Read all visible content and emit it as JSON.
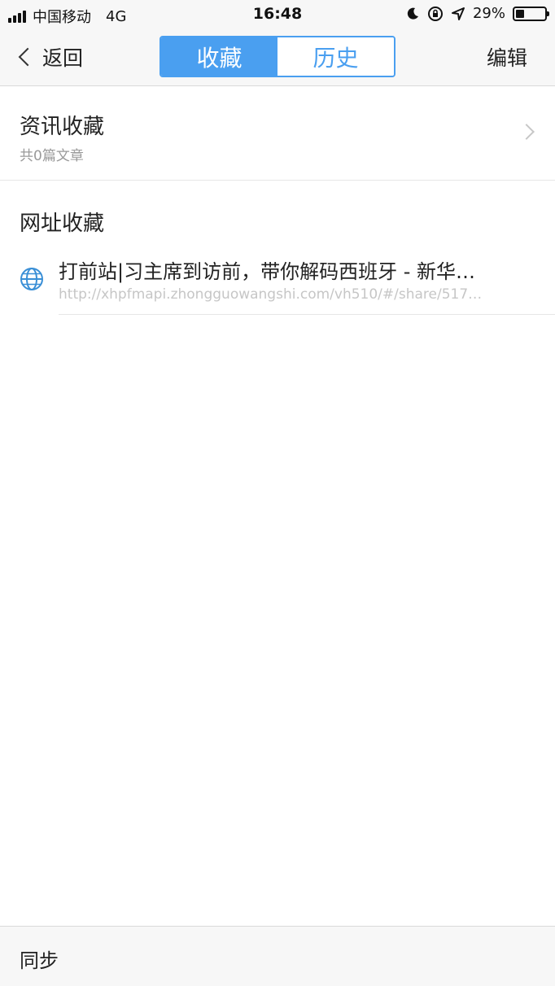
{
  "status_bar": {
    "carrier": "中国移动",
    "network": "4G",
    "time": "16:48",
    "battery_percent_text": "29%",
    "battery_level": 0.29
  },
  "nav": {
    "back_label": "返回",
    "tabs": [
      {
        "label": "收藏",
        "active": true
      },
      {
        "label": "历史",
        "active": false
      }
    ],
    "edit_label": "编辑"
  },
  "news_favorites": {
    "title": "资讯收藏",
    "subtitle": "共0篇文章"
  },
  "url_favorites": {
    "title": "网址收藏",
    "items": [
      {
        "title": "打前站|习主席到访前，带你解码西班牙 - 新华…",
        "url": "http://xhpfmapi.zhongguowangshi.com/vh510/#/share/517…"
      }
    ]
  },
  "bottom": {
    "sync_label": "同步"
  },
  "colors": {
    "accent": "#4a9ff0",
    "bar_bg": "#f7f7f7"
  }
}
